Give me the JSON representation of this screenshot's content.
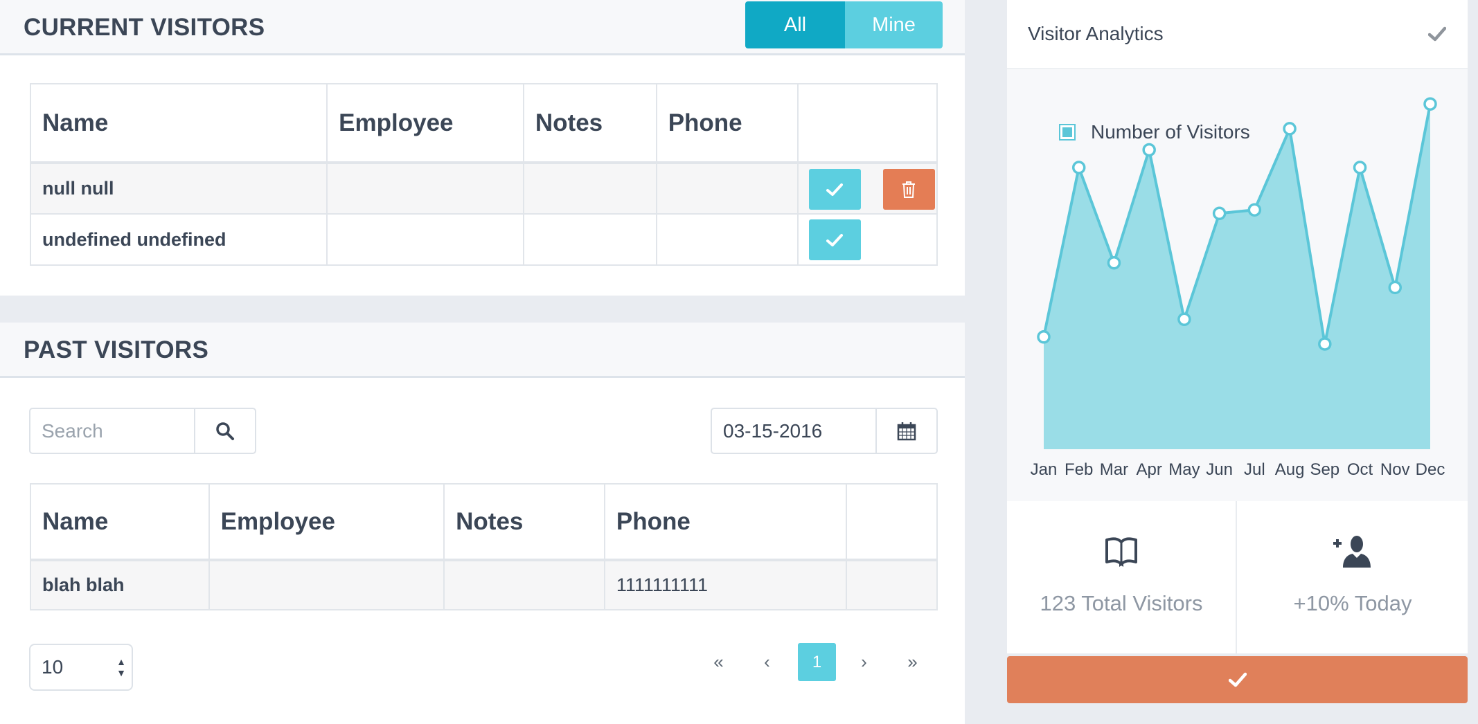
{
  "current_visitors": {
    "title": "CURRENT VISITORS",
    "filter": {
      "all_label": "All",
      "mine_label": "Mine",
      "selected": "All"
    },
    "columns": [
      "Name",
      "Employee",
      "Notes",
      "Phone",
      ""
    ],
    "rows": [
      {
        "name": "null null",
        "employee": "",
        "notes": "",
        "phone": "",
        "actions": [
          "check-icon",
          "trash-icon"
        ]
      },
      {
        "name": "undefined undefined",
        "employee": "",
        "notes": "",
        "phone": "",
        "actions": [
          "check-icon"
        ]
      }
    ]
  },
  "past_visitors": {
    "title": "PAST VISITORS",
    "search": {
      "placeholder": "Search",
      "value": ""
    },
    "date": {
      "value": "03-15-2016"
    },
    "columns": [
      "Name",
      "Employee",
      "Notes",
      "Phone",
      ""
    ],
    "rows": [
      {
        "name": "blah blah",
        "employee": "",
        "notes": "",
        "phone": "1111111111"
      }
    ],
    "per_page": "10",
    "pagination": {
      "first": "«",
      "prev": "‹",
      "current": "1",
      "next": "›",
      "last": "»"
    }
  },
  "analytics": {
    "title": "Visitor Analytics",
    "stats": [
      {
        "icon": "book-icon",
        "label": "123 Total Visitors"
      },
      {
        "icon": "add-user-icon",
        "label": "+10% Today"
      }
    ]
  },
  "colors": {
    "accent": "#5ccfe0",
    "accent_dark": "#10a9c5",
    "danger": "#e47d55",
    "chart_fill": "#9adde7",
    "chart_line": "#5bc6d8"
  },
  "chart_data": {
    "type": "area",
    "categories": [
      "Jan",
      "Feb",
      "Mar",
      "Apr",
      "May",
      "Jun",
      "Jul",
      "Aug",
      "Sep",
      "Oct",
      "Nov",
      "Dec"
    ],
    "series": [
      {
        "name": "Number of Visitors",
        "values": [
          32,
          80,
          53,
          85,
          37,
          67,
          68,
          91,
          30,
          80,
          46,
          98
        ]
      }
    ],
    "ylim": [
      0,
      100
    ],
    "legend": "top-left",
    "grid": false
  }
}
